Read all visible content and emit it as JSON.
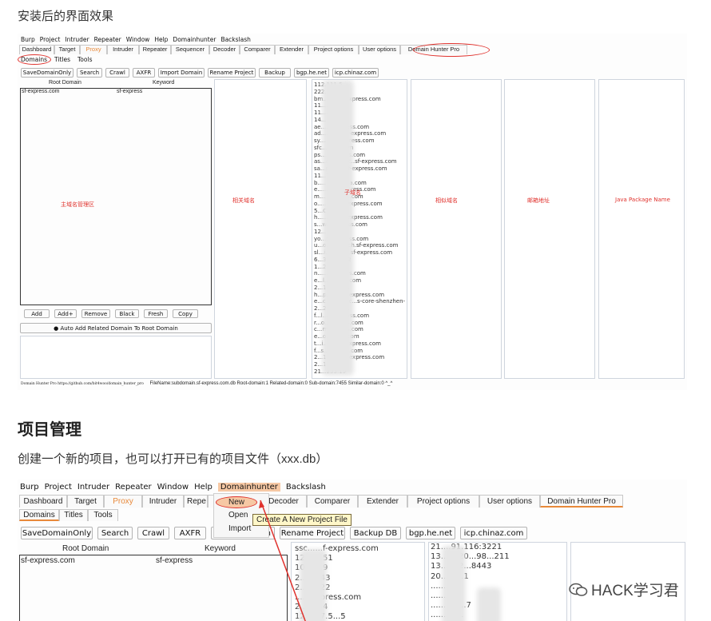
{
  "article": {
    "intro_text": "安装后的界面效果",
    "section_title": "项目管理",
    "section_desc": "创建一个新的项目，也可以打开已有的项目文件（xxx.db）",
    "watermark": "HACK学习君"
  },
  "shot1": {
    "menu": [
      "Burp",
      "Project",
      "Intruder",
      "Repeater",
      "Window",
      "Help",
      "Domainhunter",
      "Backslash"
    ],
    "tabs": [
      "Dashboard",
      "Target",
      "Proxy",
      "Intruder",
      "Repeater",
      "Sequencer",
      "Decoder",
      "Comparer",
      "Extender",
      "Project options",
      "User options",
      "Domain Hunter Pro"
    ],
    "subtabs": [
      "Domains",
      "Titles",
      "Tools"
    ],
    "toolbar": [
      "SaveDomainOnly",
      "Search",
      "Crawl",
      "AXFR",
      "Import Domain",
      "Rename Project",
      "Backup DB",
      "bgp.he.net",
      "icp.chinaz.com"
    ],
    "columns": {
      "root_domain": "Root Domain",
      "keyword": "Keyword"
    },
    "row": {
      "root": "sf-express.com",
      "keyword": "sf-express"
    },
    "action_buttons": [
      "Add",
      "Add+",
      "Remove",
      "Black",
      "Fresh",
      "Copy"
    ],
    "auto_add": "● Auto Add Related Domain To Root Domain",
    "panel_labels": {
      "main": "主域名管理区",
      "related": "相关域名",
      "subdomain": "子域名",
      "similar": "相似域名",
      "email": "邮箱地址",
      "java": "Java Package Name"
    },
    "subdomain_lines": [
      "112.111.5...",
      "222.1...",
      "bm...c...e...express.com",
      "11...3...19",
      "11...3...1.0",
      "14...1...54",
      "ae...........press.com",
      "ad.............sf-express.com",
      "sy...........express.com",
      "sfc...........com",
      "ps.........press.com",
      "as...ac.......gc..sf-express.com",
      "sa...p.........sf-express.com",
      "11...2...25",
      "b.........e.......a.com",
      "e.............express.com",
      "m.............e...com",
      "o.............sf-express.com",
      "5...C.........",
      "h.............sf-express.com",
      "s...w.........ress.com",
      "12.......60",
      "yo...p.........ess.com",
      "u...o...........rch.sf-express.com",
      "sl...i...xp...t...sf-express.com",
      "6...3...22...32",
      "1...2...3...",
      "n.............ress.com",
      "e...l.........p...com",
      "2...1...9...8...",
      "h...p.........sf-express.com",
      "e...c...e...e...c...s-core-shenzhen-",
      "2...2...8...8...",
      "f...l...k...sf...ess.com",
      "r...o.........ess.com",
      "c...m.........ss.com",
      "e...o.........a.com",
      "t...i.........sf-express.com",
      "f...s.........ess.com",
      "2...1.........sf-express.com",
      "2...1...0...",
      "21...233.19"
    ],
    "status": {
      "left": "Domain Hunter Pro    https://github.com/bit4woo/domain_hunter_pro",
      "right": "FileName:subdomain.sf-express.com.db  Root-domain:1  Related-domain:0  Sub-domain:7455  Similar-domain:0  ^_^"
    }
  },
  "shot2": {
    "menu": [
      "Burp",
      "Project",
      "Intruder",
      "Repeater",
      "Window",
      "Help",
      "Domainhunter",
      "Backslash"
    ],
    "tabs": [
      "Dashboard",
      "Target",
      "Proxy",
      "Intruder",
      "Repe",
      "uencer",
      "Decoder",
      "Comparer",
      "Extender",
      "Project options",
      "User options",
      "Domain Hunter Pro"
    ],
    "subtabs": [
      "Domains",
      "Titles",
      "Tools"
    ],
    "toolbar": [
      "SaveDomainOnly",
      "Search",
      "Crawl",
      "AXFR",
      "main",
      "Rename Project",
      "Backup DB",
      "bgp.he.net",
      "icp.chinaz.com"
    ],
    "columns": {
      "root_domain": "Root Domain",
      "keyword": "Keyword"
    },
    "row": {
      "root": "sf-express.com",
      "keyword": "sf-express"
    },
    "dropdown": [
      "New",
      "Open",
      "Import"
    ],
    "tooltip": "Create A New Project File",
    "list_a": [
      "ssc......f-express.com",
      "12.......51",
      "10.......9",
      "2........43",
      "2........22",
      "..........press.com",
      "2.......44",
      "12..267.5...5"
    ],
    "list_b": [
      "21....91.116:3221",
      "13....9.20...98...211",
      "13....9.2...8443",
      "20.........1",
      "..........",
      "..........3",
      ".........3...7",
      "..........3."
    ],
    "colors": {
      "accent": "#e8893a",
      "annotation": "#e0322d",
      "highlight": "#f6c8a4"
    }
  }
}
